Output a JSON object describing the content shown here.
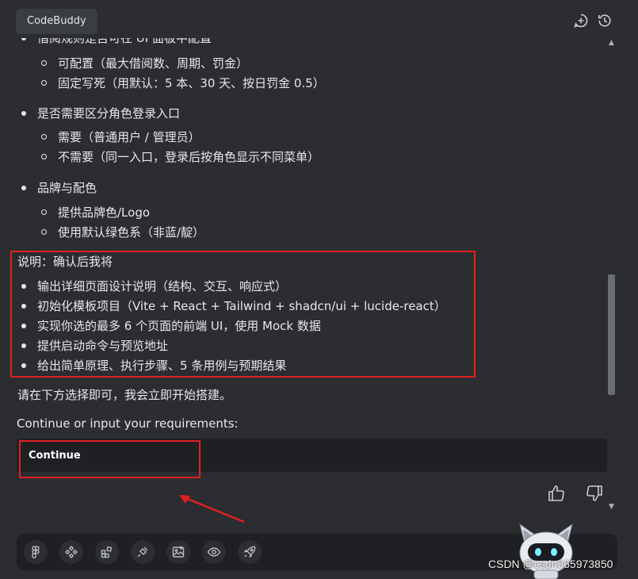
{
  "header": {
    "tab_label": "CodeBuddy",
    "icons": [
      "add-chat-icon",
      "history-icon"
    ]
  },
  "content": {
    "cut_top_line": "借阅规则是否可在 UI 面板中配置",
    "group1": [
      "可配置（最大借阅数、周期、罚金）",
      "固定写死（用默认：5 本、30 天、按日罚金 0.5）"
    ],
    "q2": "是否需要区分角色登录入口",
    "group2": [
      "需要（普通用户 / 管理员）",
      "不需要（同一入口，登录后按角色显示不同菜单）"
    ],
    "q3": "品牌与配色",
    "group3": [
      "提供品牌色/Logo",
      "使用默认绿色系（非蓝/靛）"
    ],
    "note_title": "说明：确认后我将",
    "note_items": [
      "输出详细页面设计说明（结构、交互、响应式）",
      "初始化模板项目（Vite + React + Tailwind + shadcn/ui + lucide-react）",
      "实现你选的最多 6 个页面的前端 UI，使用 Mock 数据",
      "提供启动命令与预览地址",
      "给出简单原理、执行步骤、5 条用例与预期结果"
    ],
    "closing": "请在下方选择即可，我会立即开始搭建。",
    "prompt_label": "Continue or input your requirements:",
    "continue_option": "Continue"
  },
  "toolbar": {
    "icons": [
      "figma-icon",
      "components-icon",
      "blocks-icon",
      "plugin-icon",
      "image-upload-icon",
      "preview-eye-icon",
      "rocket-icon"
    ]
  },
  "watermark": "CSDN @csdn565973850",
  "colors": {
    "background": "#2b2d30",
    "input": "#1f2023",
    "annotation": "#e02020"
  }
}
